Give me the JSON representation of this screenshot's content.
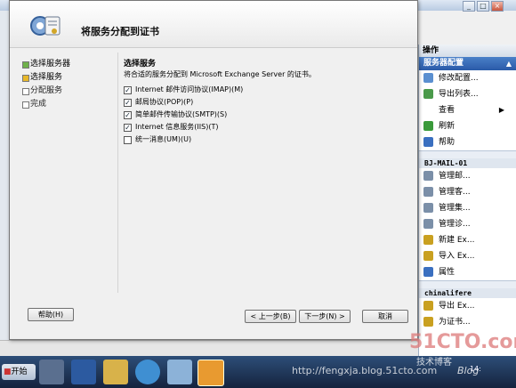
{
  "wizard": {
    "title": "将服务分配到证书",
    "nav": [
      {
        "label": "选择服务器",
        "state": "done"
      },
      {
        "label": "选择服务",
        "state": "current"
      },
      {
        "label": "分配服务",
        "state": "pending"
      },
      {
        "label": "完成",
        "state": "pending"
      }
    ],
    "section_title": "选择服务",
    "section_desc": "将合适的服务分配到 Microsoft Exchange Server 的证书。",
    "services": [
      {
        "label": "Internet 邮件访问协议(IMAP)(M)",
        "checked": true
      },
      {
        "label": "邮局协议(POP)(P)",
        "checked": true
      },
      {
        "label": "简单邮件传输协议(SMTP)(S)",
        "checked": true
      },
      {
        "label": "Internet 信息服务(IIS)(T)",
        "checked": true
      },
      {
        "label": "统一消息(UM)(U)",
        "checked": false
      }
    ],
    "buttons": {
      "help": "帮助(H)",
      "back": "< 上一步(B)",
      "next": "下一步(N) >",
      "cancel": "取消"
    }
  },
  "actions": {
    "header": "操作",
    "section": "服务器配置",
    "items": [
      {
        "label": "修改配置...",
        "icon": "edit-config-icon",
        "color": "#5a8fd0"
      },
      {
        "label": "导出列表...",
        "icon": "export-list-icon",
        "color": "#4a9a4a"
      },
      {
        "label": "查看",
        "icon": "view-icon",
        "color": ""
      },
      {
        "label": "刷新",
        "icon": "refresh-icon",
        "color": "#3a9a3a"
      },
      {
        "label": "帮助",
        "icon": "help-icon",
        "color": "#3a6fc0"
      }
    ],
    "server_name": "BJ-MAIL-01",
    "server_items": [
      {
        "label": "管理邮...",
        "icon": "manage-mail-icon",
        "color": "#7b8fa8"
      },
      {
        "label": "管理客...",
        "icon": "manage-client-icon",
        "color": "#7b8fa8"
      },
      {
        "label": "管理集...",
        "icon": "manage-hub-icon",
        "color": "#7b8fa8"
      },
      {
        "label": "管理诊...",
        "icon": "manage-diag-icon",
        "color": "#7b8fa8"
      },
      {
        "label": "新建 Ex...",
        "icon": "new-cert-icon",
        "color": "#c9a020"
      },
      {
        "label": "导入 Ex...",
        "icon": "import-cert-icon",
        "color": "#c9a020"
      },
      {
        "label": "属性",
        "icon": "properties-icon",
        "color": "#3a6fc0"
      }
    ],
    "cert_name": "chinalifere",
    "cert_items": [
      {
        "label": "导出 Ex...",
        "icon": "export-cert-icon",
        "color": "#c9a020"
      },
      {
        "label": "为证书...",
        "icon": "assign-cert-icon",
        "color": "#c9a020"
      }
    ]
  },
  "taskbar": {
    "start_label": "开始",
    "clock": "14:"
  },
  "watermark": {
    "logo": "51CTO.com",
    "sub": "技术博客",
    "blog": "Blog",
    "url": "http://fengxja.blog.51cto.com"
  }
}
